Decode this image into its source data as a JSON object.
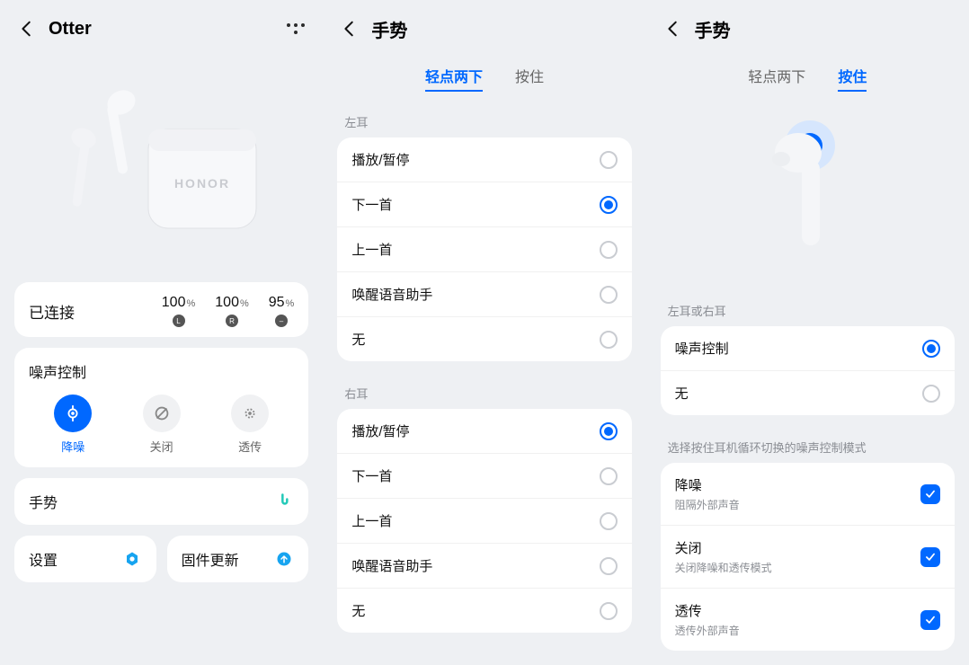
{
  "colors": {
    "accent": "#0068ff"
  },
  "screen1": {
    "title": "Otter",
    "status": "已连接",
    "battery": [
      {
        "value": "100",
        "unit": "%",
        "badge": "L"
      },
      {
        "value": "100",
        "unit": "%",
        "badge": "R"
      },
      {
        "value": "95",
        "unit": "%",
        "badge": "–"
      }
    ],
    "noise_control_title": "噪声控制",
    "noise_modes": [
      {
        "label": "降噪",
        "active": true
      },
      {
        "label": "关闭",
        "active": false
      },
      {
        "label": "透传",
        "active": false
      }
    ],
    "gestures_label": "手势",
    "settings_label": "设置",
    "firmware_label": "固件更新"
  },
  "screen2": {
    "title": "手势",
    "tabs": {
      "tap": "轻点两下",
      "hold": "按住"
    },
    "active_tab": "tap",
    "left_ear_label": "左耳",
    "right_ear_label": "右耳",
    "options_left": [
      {
        "label": "播放/暂停",
        "selected": false
      },
      {
        "label": "下一首",
        "selected": true
      },
      {
        "label": "上一首",
        "selected": false
      },
      {
        "label": "唤醒语音助手",
        "selected": false
      },
      {
        "label": "无",
        "selected": false
      }
    ],
    "options_right": [
      {
        "label": "播放/暂停",
        "selected": true
      },
      {
        "label": "下一首",
        "selected": false
      },
      {
        "label": "上一首",
        "selected": false
      },
      {
        "label": "唤醒语音助手",
        "selected": false
      },
      {
        "label": "无",
        "selected": false
      }
    ]
  },
  "screen3": {
    "title": "手势",
    "tabs": {
      "tap": "轻点两下",
      "hold": "按住"
    },
    "active_tab": "hold",
    "either_ear_label": "左耳或右耳",
    "hold_options": [
      {
        "label": "噪声控制",
        "selected": true
      },
      {
        "label": "无",
        "selected": false
      }
    ],
    "cycle_label": "选择按住耳机循环切换的噪声控制模式",
    "cycle_options": [
      {
        "label": "降噪",
        "sub": "阻隔外部声音",
        "checked": true
      },
      {
        "label": "关闭",
        "sub": "关闭降噪和透传模式",
        "checked": true
      },
      {
        "label": "透传",
        "sub": "透传外部声音",
        "checked": true
      }
    ]
  }
}
